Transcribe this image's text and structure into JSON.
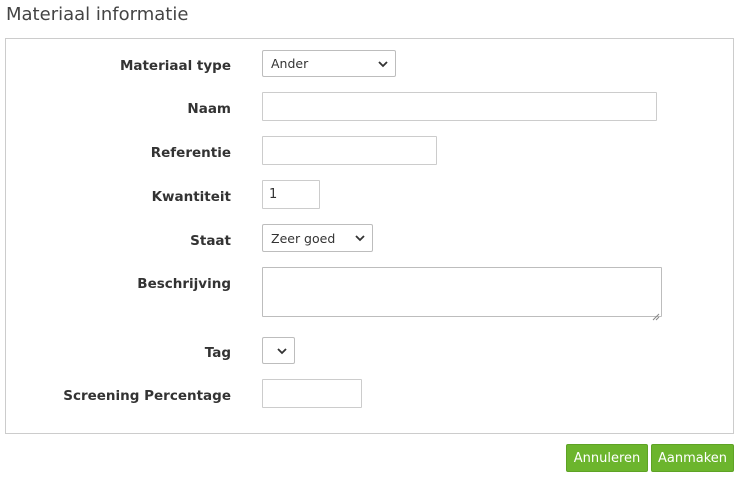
{
  "page": {
    "title": "Materiaal informatie"
  },
  "form": {
    "material_type": {
      "label": "Materiaal type",
      "selected": "Ander"
    },
    "name": {
      "label": "Naam",
      "value": ""
    },
    "reference": {
      "label": "Referentie",
      "value": ""
    },
    "quantity": {
      "label": "Kwantiteit",
      "value": "1"
    },
    "condition": {
      "label": "Staat",
      "selected": "Zeer goed"
    },
    "description": {
      "label": "Beschrijving",
      "value": ""
    },
    "tag": {
      "label": "Tag",
      "selected": ""
    },
    "screening": {
      "label": "Screening Percentage",
      "value": ""
    }
  },
  "actions": {
    "cancel_label": "Annuleren",
    "create_label": "Aanmaken"
  },
  "colors": {
    "button_green": "#6cb52d",
    "border": "#cccccc",
    "text": "#333333"
  }
}
